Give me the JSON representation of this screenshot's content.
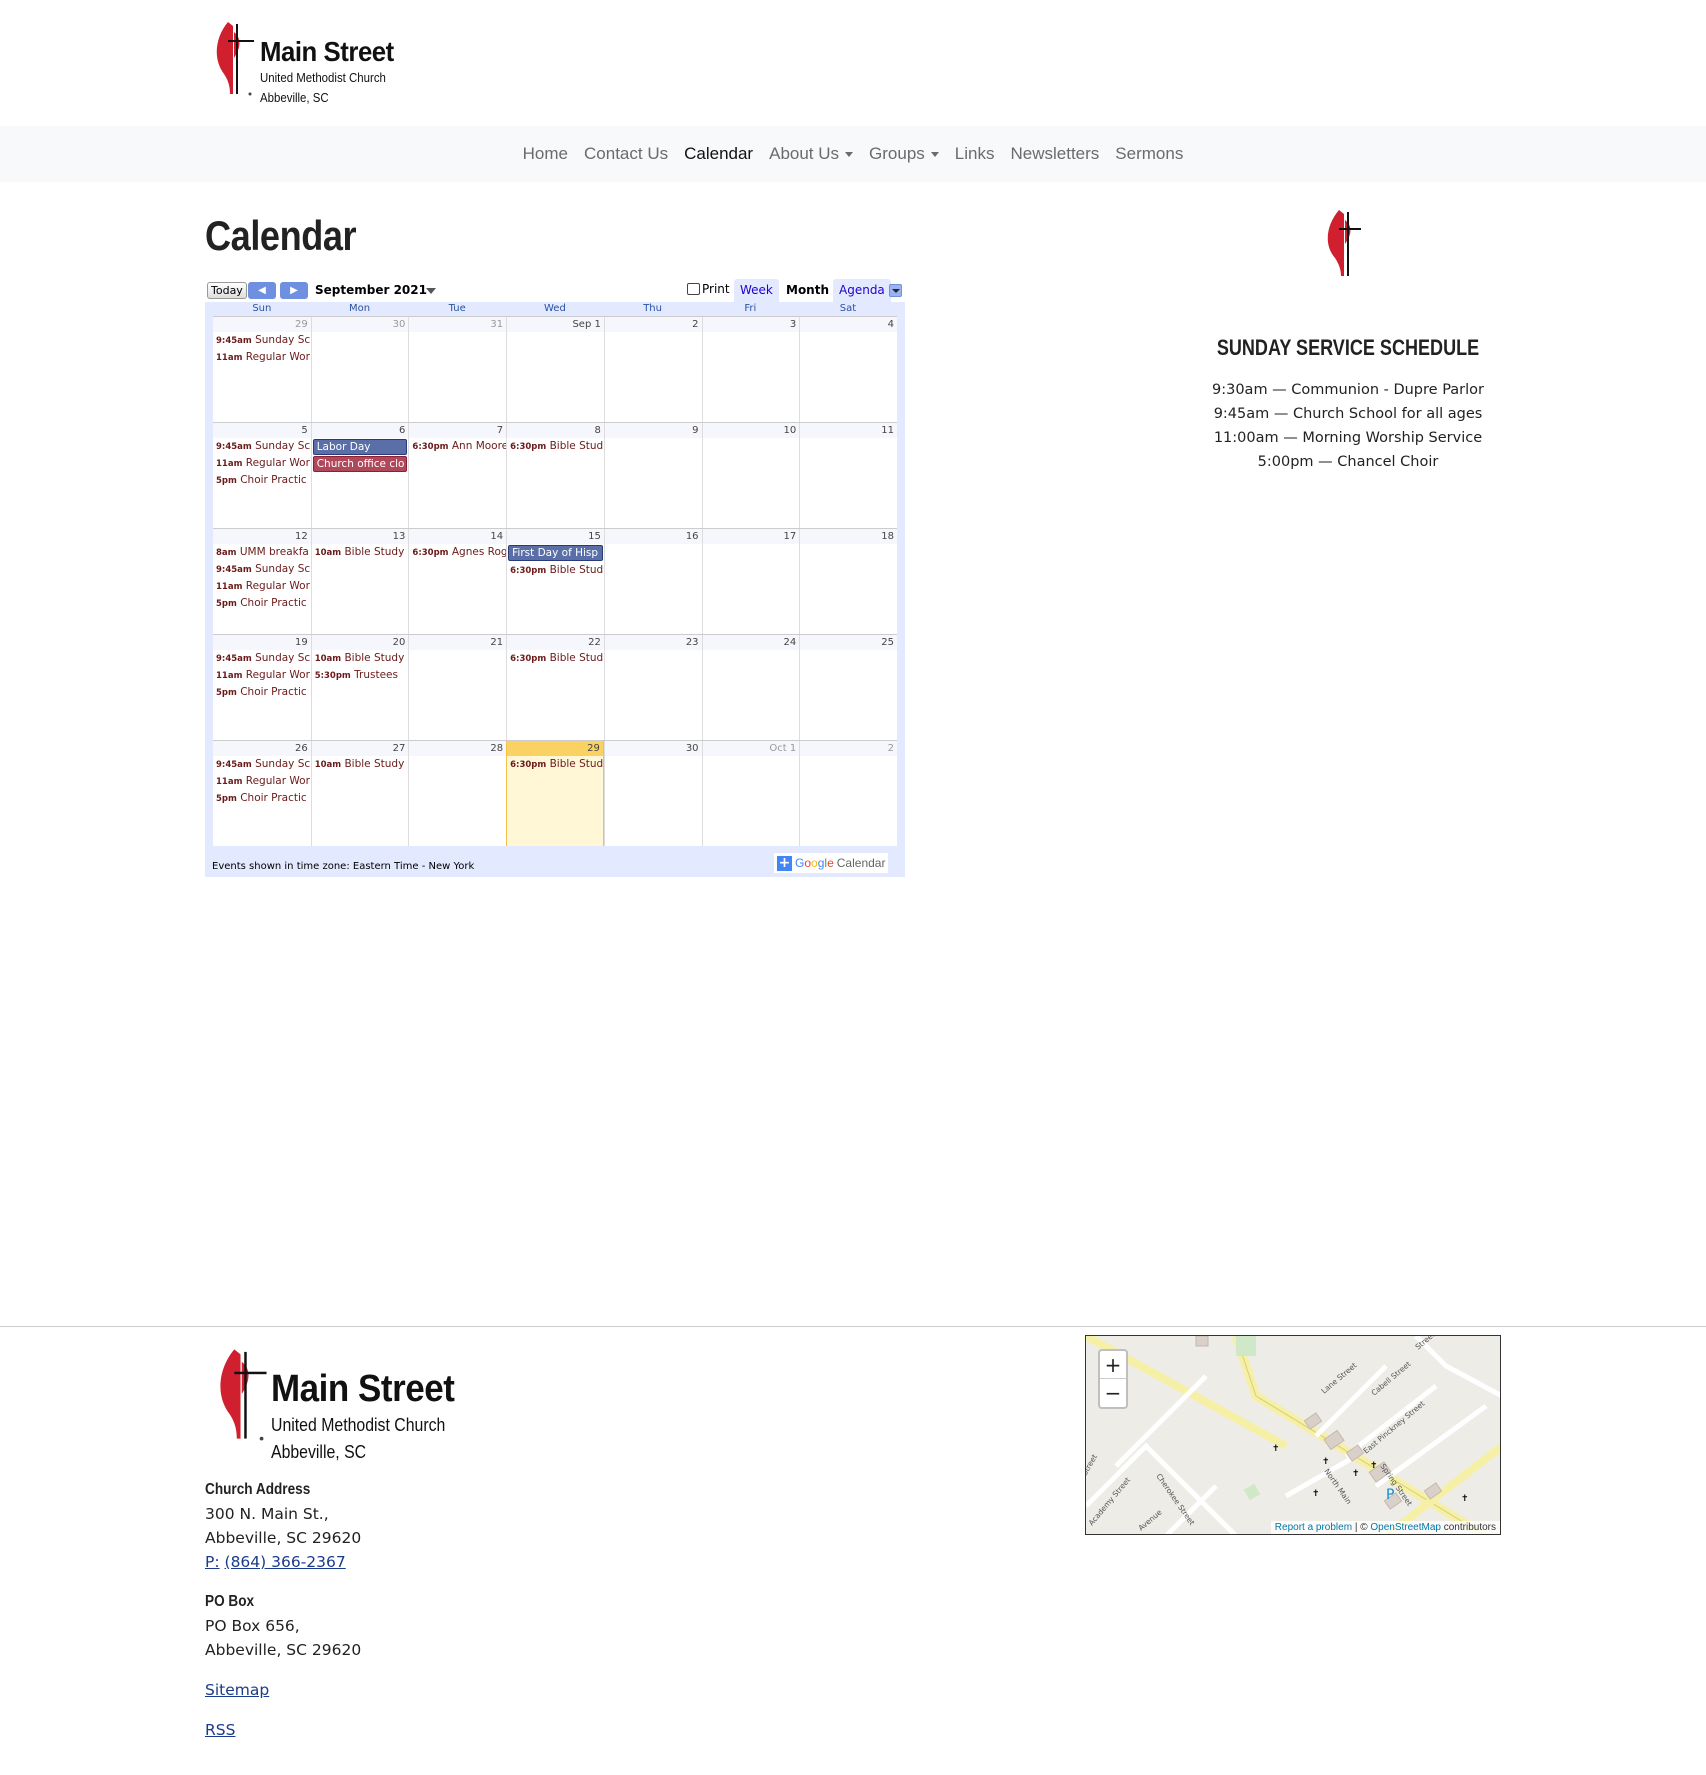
{
  "brand": {
    "name": "Main Street",
    "subtitle": "United Methodist Church",
    "location": "Abbeville, SC"
  },
  "nav": {
    "items": [
      {
        "label": "Home"
      },
      {
        "label": "Contact Us"
      },
      {
        "label": "Calendar"
      },
      {
        "label": "About Us"
      },
      {
        "label": "Groups"
      },
      {
        "label": "Links"
      },
      {
        "label": "Newsletters"
      },
      {
        "label": "Sermons"
      }
    ]
  },
  "page": {
    "title": "Calendar"
  },
  "calendar": {
    "today_label": "Today",
    "month_label": "September 2021",
    "print_label": "Print",
    "views": [
      "Week",
      "Month",
      "Agenda"
    ],
    "selected_view": "Month",
    "dow": [
      "Sun",
      "Mon",
      "Tue",
      "Wed",
      "Thu",
      "Fri",
      "Sat"
    ],
    "timezone_note": "Events shown in time zone: Eastern Time - New York",
    "brand_label": "Calendar",
    "weeks": [
      [
        {
          "num": "29",
          "other": true,
          "events": [
            {
              "t": "9:45am",
              "n": "Sunday Sc"
            },
            {
              "t": "11am",
              "n": "Regular Wor"
            }
          ]
        },
        {
          "num": "30",
          "other": true,
          "events": []
        },
        {
          "num": "31",
          "other": true,
          "events": []
        },
        {
          "num": "Sep 1",
          "events": []
        },
        {
          "num": "2",
          "events": []
        },
        {
          "num": "3",
          "events": []
        },
        {
          "num": "4",
          "events": []
        }
      ],
      [
        {
          "num": "5",
          "events": [
            {
              "t": "9:45am",
              "n": "Sunday Sc"
            },
            {
              "t": "11am",
              "n": "Regular Wor"
            },
            {
              "t": "5pm",
              "n": "Choir Practic"
            }
          ]
        },
        {
          "num": "6",
          "allday": [
            {
              "n": "Labor Day",
              "c": "blue"
            },
            {
              "n": "Church office clo",
              "c": "red"
            }
          ],
          "events": []
        },
        {
          "num": "7",
          "events": [
            {
              "t": "6:30pm",
              "n": "Ann Moore"
            }
          ]
        },
        {
          "num": "8",
          "events": [
            {
              "t": "6:30pm",
              "n": "Bible Stud"
            }
          ]
        },
        {
          "num": "9",
          "events": []
        },
        {
          "num": "10",
          "events": []
        },
        {
          "num": "11",
          "events": []
        }
      ],
      [
        {
          "num": "12",
          "events": [
            {
              "t": "8am",
              "n": "UMM breakfa"
            },
            {
              "t": "9:45am",
              "n": "Sunday Sc"
            },
            {
              "t": "11am",
              "n": "Regular Wor"
            },
            {
              "t": "5pm",
              "n": "Choir Practic"
            }
          ]
        },
        {
          "num": "13",
          "events": [
            {
              "t": "10am",
              "n": "Bible Study"
            }
          ]
        },
        {
          "num": "14",
          "events": [
            {
              "t": "6:30pm",
              "n": "Agnes Rog"
            }
          ]
        },
        {
          "num": "15",
          "allday": [
            {
              "n": "First Day of Hisp",
              "c": "blue"
            }
          ],
          "events": [
            {
              "t": "6:30pm",
              "n": "Bible Stud"
            }
          ]
        },
        {
          "num": "16",
          "events": []
        },
        {
          "num": "17",
          "events": []
        },
        {
          "num": "18",
          "events": []
        }
      ],
      [
        {
          "num": "19",
          "events": [
            {
              "t": "9:45am",
              "n": "Sunday Sc"
            },
            {
              "t": "11am",
              "n": "Regular Wor"
            },
            {
              "t": "5pm",
              "n": "Choir Practic"
            }
          ]
        },
        {
          "num": "20",
          "events": [
            {
              "t": "10am",
              "n": "Bible Study"
            },
            {
              "t": "5:30pm",
              "n": "Trustees"
            }
          ]
        },
        {
          "num": "21",
          "events": []
        },
        {
          "num": "22",
          "events": [
            {
              "t": "6:30pm",
              "n": "Bible Stud"
            }
          ]
        },
        {
          "num": "23",
          "events": []
        },
        {
          "num": "24",
          "events": []
        },
        {
          "num": "25",
          "events": []
        }
      ],
      [
        {
          "num": "26",
          "events": [
            {
              "t": "9:45am",
              "n": "Sunday Sc"
            },
            {
              "t": "11am",
              "n": "Regular Wor"
            },
            {
              "t": "5pm",
              "n": "Choir Practic"
            }
          ]
        },
        {
          "num": "27",
          "events": [
            {
              "t": "10am",
              "n": "Bible Study"
            }
          ]
        },
        {
          "num": "28",
          "events": []
        },
        {
          "num": "29",
          "today": true,
          "events": [
            {
              "t": "6:30pm",
              "n": "Bible Stud"
            }
          ]
        },
        {
          "num": "30",
          "events": []
        },
        {
          "num": "Oct 1",
          "other": true,
          "events": []
        },
        {
          "num": "2",
          "other": true,
          "events": []
        }
      ]
    ]
  },
  "sidebar": {
    "schedule_title": "SUNDAY SERVICE SCHEDULE",
    "schedule": [
      "9:30am — Communion - Dupre Parlor",
      "9:45am — Church School for all ages",
      "11:00am — Morning Worship Service",
      "5:00pm — Chancel Choir"
    ]
  },
  "footer": {
    "address_heading": "Church Address",
    "address_line1": "300 N. Main St.,",
    "address_line2": "Abbeville, SC 29620",
    "phone_prefix": "P:",
    "phone": "(864) 366-2367",
    "pobox_heading": "PO Box",
    "pobox_line1": "PO Box 656,",
    "pobox_line2": "Abbeville, SC 29620",
    "sitemap": "Sitemap",
    "rss": "RSS"
  },
  "map": {
    "zoom_in": "+",
    "zoom_out": "−",
    "report": "Report a problem",
    "osm": "OpenStreetMap",
    "osm_suffix": "contributors",
    "copyright": "| ©",
    "streets": [
      "Lane Street",
      "Cabell Street",
      "East Pinckney Street",
      "Spring Street",
      "North Main",
      "Cherokee Street",
      "Academy Street",
      "Avenue",
      "Street",
      "Street"
    ],
    "parking": "P"
  },
  "colors": {
    "accent_red": "#d0202f",
    "link": "#1a3a8a",
    "nav_bg": "#f8f9fa",
    "cal_frame": "#e3e9ff"
  }
}
